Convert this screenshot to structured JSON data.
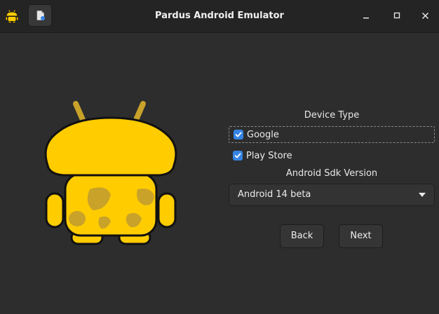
{
  "window": {
    "title": "Pardus Android Emulator"
  },
  "header": {
    "app_icon": "android-mascot-icon",
    "menu_button_icon": "document-icon",
    "controls": [
      "minimize-icon",
      "maximize-icon",
      "close-icon"
    ]
  },
  "form": {
    "device_type_label": "Device Type",
    "options": [
      {
        "label": "Google",
        "checked": true
      },
      {
        "label": "Play Store",
        "checked": true
      }
    ],
    "sdk_label": "Android Sdk Version",
    "sdk_selected": "Android 14 beta"
  },
  "buttons": {
    "back": "Back",
    "next": "Next"
  },
  "colors": {
    "mascot_yellow": "#ffcc00",
    "mascot_spots": "#c9a22a",
    "accent": "#3584e4",
    "background": "#2d2d2d",
    "titlebar": "#242424"
  }
}
